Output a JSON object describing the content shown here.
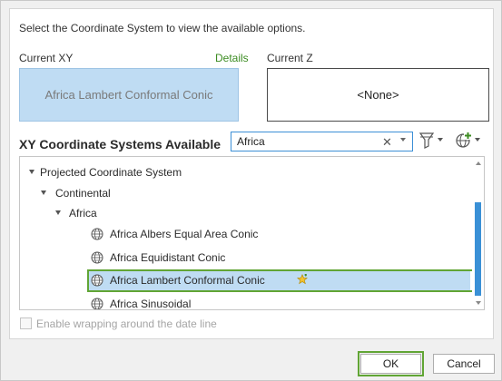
{
  "instruction": "Select the Coordinate System to view the available options.",
  "current_xy": {
    "label": "Current XY",
    "details_link": "Details",
    "value": "Africa Lambert Conformal Conic"
  },
  "current_z": {
    "label": "Current Z",
    "value": "<None>"
  },
  "available": {
    "title": "XY Coordinate Systems Available",
    "search": {
      "value": "Africa",
      "placeholder": ""
    }
  },
  "tree": {
    "items": [
      {
        "label": "Projected Coordinate System",
        "type": "folder",
        "expanded": true
      },
      {
        "label": "Continental",
        "type": "folder",
        "expanded": true
      },
      {
        "label": "Africa",
        "type": "folder",
        "expanded": true
      },
      {
        "label": "Africa Albers Equal Area Conic",
        "type": "coordinate-system"
      },
      {
        "label": "Africa Equidistant Conic",
        "type": "coordinate-system"
      },
      {
        "label": "Africa Lambert Conformal Conic",
        "type": "coordinate-system",
        "selected": true,
        "favorite": true
      },
      {
        "label": "Africa Sinusoidal",
        "type": "coordinate-system"
      }
    ]
  },
  "wrap_option": {
    "label": "Enable wrapping around the date line",
    "checked": false,
    "enabled": false
  },
  "buttons": {
    "ok": "OK",
    "cancel": "Cancel"
  },
  "colors": {
    "selection": "#bfdcf3",
    "highlight_outline": "#61a535",
    "link": "#3c8c22",
    "scroll_thumb": "#3a90d6"
  }
}
